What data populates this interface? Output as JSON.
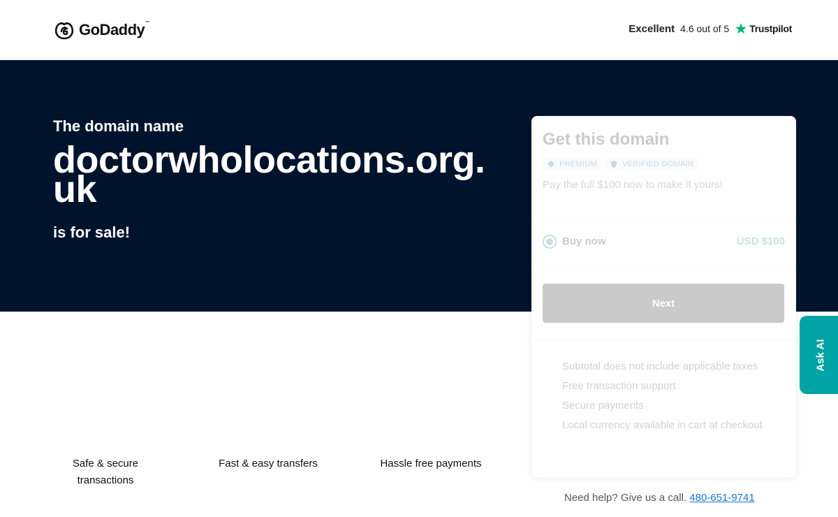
{
  "header": {
    "logo_text": "GoDaddy",
    "logo_tm": "™",
    "rating_word": "Excellent",
    "rating_score": "4.6 out of 5",
    "rating_provider": "Trustpilot",
    "trustpilot_color": "#00b67a"
  },
  "hero": {
    "pre": "The domain name",
    "domain": "doctorwholocations.org.uk",
    "post": "is for sale!",
    "background": "#00132d"
  },
  "card": {
    "title": "Get this domain",
    "badges": [
      "PREMIUM",
      "VERIFIED DOMAIN"
    ],
    "subtitle": "Pay the full $100 now to make it yours!",
    "option_label": "Buy now",
    "option_price": "USD $100",
    "next_label": "Next",
    "features": [
      "Subtotal does not include applicable taxes",
      "Free transaction support",
      "Secure payments",
      "Local currency available in cart at checkout"
    ]
  },
  "trust_points": [
    "Safe & secure transactions",
    "Fast & easy transfers",
    "Hassle free payments"
  ],
  "help": {
    "text": "Need help? Give us a call.",
    "phone": "480-651-9741"
  },
  "ask_ai": {
    "label": "Ask AI",
    "color": "#00a4a6"
  }
}
